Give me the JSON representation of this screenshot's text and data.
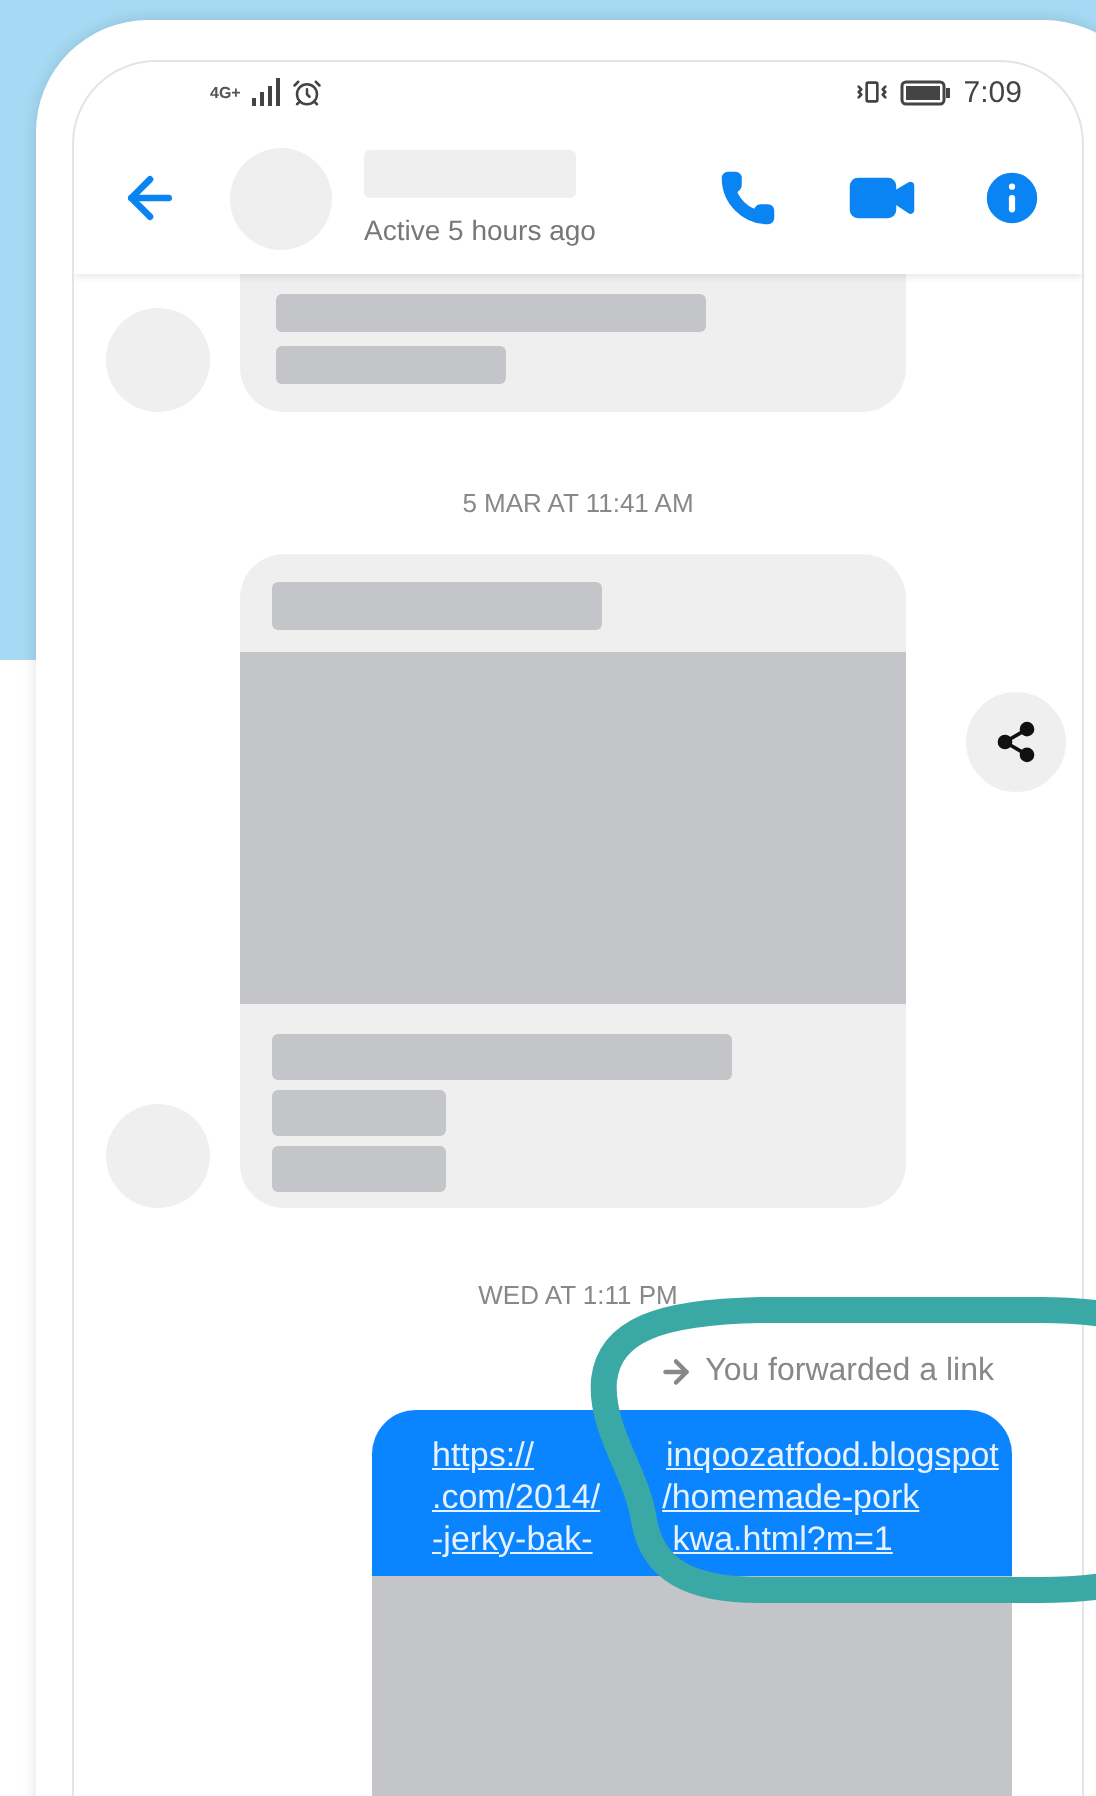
{
  "status_bar": {
    "network": "4G+",
    "time": "7:09"
  },
  "header": {
    "status": "Active 5 hours ago"
  },
  "messages": [
    {
      "kind": "timestamp",
      "text": "5 MAR AT 11:41 AM"
    },
    {
      "kind": "timestamp",
      "text": "WED AT 1:11 PM"
    },
    {
      "kind": "forward_note",
      "text": "You forwarded a link"
    },
    {
      "kind": "link",
      "lines": [
        [
          "https://",
          "inqoozatfood.blogspot"
        ],
        [
          ".com/2014/",
          "/homemade-pork"
        ],
        [
          "-jerky-bak-",
          "kwa.html?m=1"
        ]
      ]
    }
  ]
}
